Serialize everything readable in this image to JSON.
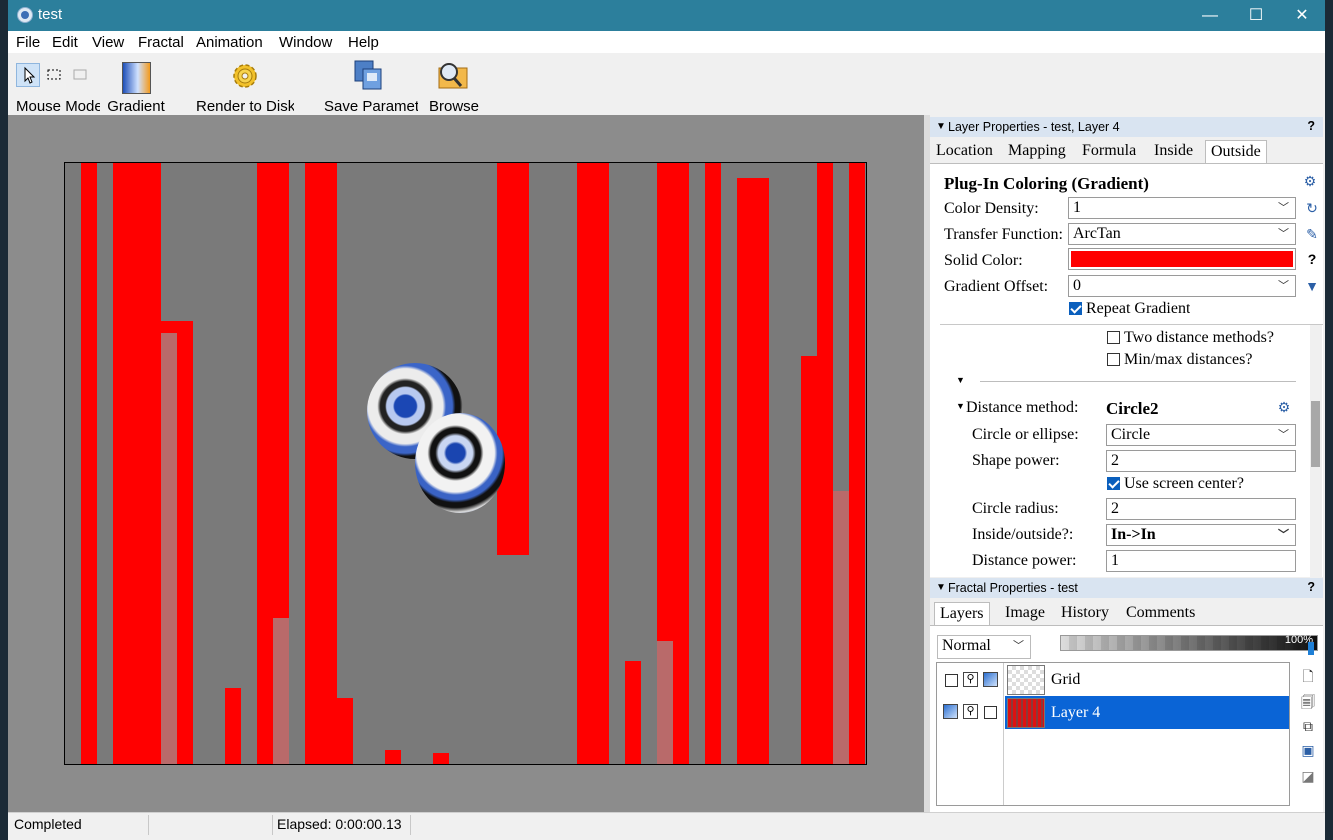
{
  "window": {
    "title": "test",
    "minimize": "—",
    "maximize": "☐",
    "close": "✕"
  },
  "menu": [
    "File",
    "Edit",
    "View",
    "Fractal",
    "Animation",
    "Window",
    "Help"
  ],
  "toolbar": {
    "mouse_mode": "Mouse Mode",
    "gradient": "Gradient",
    "render_to_disk": "Render to Disk",
    "save_parameters": "Save Parameters",
    "browse": "Browse"
  },
  "layer_props": {
    "header": "Layer Properties - test, Layer 4",
    "help": "?",
    "tabs": [
      "Location",
      "Mapping",
      "Formula",
      "Inside",
      "Outside"
    ],
    "active_tab": "Outside",
    "coloring_title": "Plug-In Coloring (Gradient)",
    "color_density_label": "Color Density:",
    "color_density": "1",
    "transfer_label": "Transfer Function:",
    "transfer": "ArcTan",
    "solid_color_label": "Solid Color:",
    "solid_color": "#ff0000",
    "solid_help": "?",
    "gradient_offset_label": "Gradient Offset:",
    "gradient_offset": "0",
    "repeat_gradient": "Repeat Gradient",
    "two_distance": "Two distance methods?",
    "minmax": "Min/max distances?",
    "distance_method_label": "Distance method:",
    "distance_method": "Circle2",
    "circle_ellipse_label": "Circle or ellipse:",
    "circle_ellipse": "Circle",
    "shape_power_label": "Shape power:",
    "shape_power": "2",
    "use_screen_center": "Use screen center?",
    "circle_radius_label": "Circle radius:",
    "circle_radius": "2",
    "inside_outside_label": "Inside/outside?:",
    "inside_outside": "In->In",
    "distance_power_label": "Distance power:",
    "distance_power": "1"
  },
  "fractal_props": {
    "header": "Fractal Properties - test",
    "help": "?",
    "tabs": [
      "Layers",
      "Image",
      "History",
      "Comments"
    ],
    "active_tab": "Layers",
    "blend_mode": "Normal",
    "opacity": "100%",
    "layers": [
      {
        "name": "Grid",
        "selected": false
      },
      {
        "name": "Layer 4",
        "selected": true
      }
    ]
  },
  "status": {
    "text": "Completed",
    "elapsed": "Elapsed: 0:00:00.13"
  }
}
